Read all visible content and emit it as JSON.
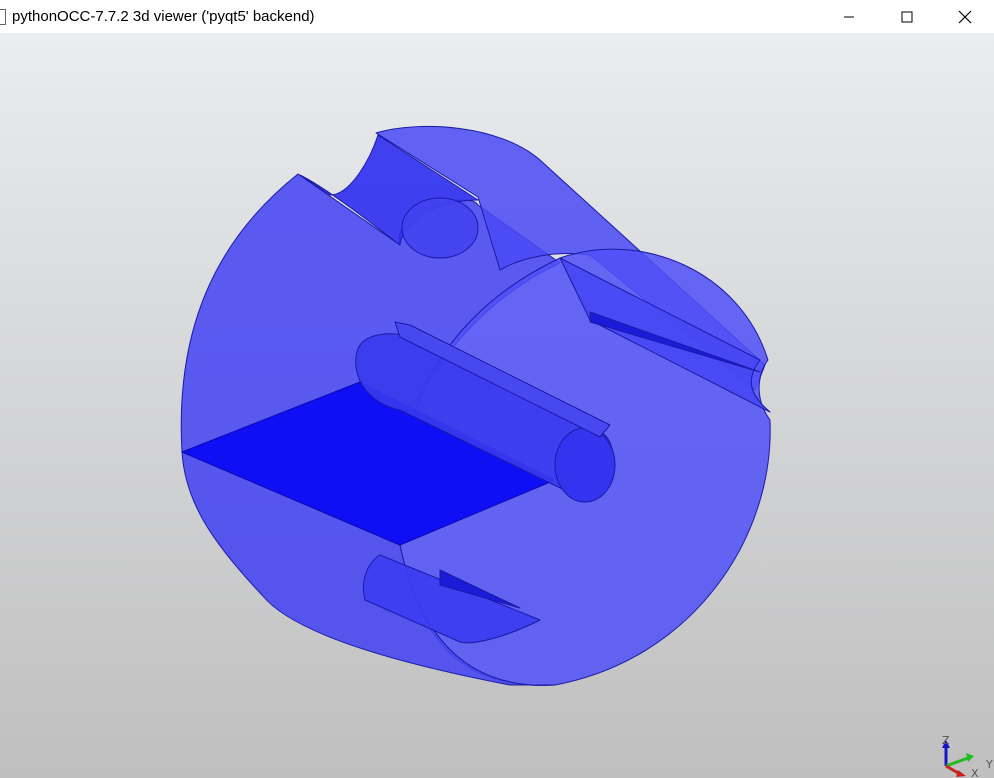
{
  "window": {
    "title": "pythonOCC-7.7.2 3d viewer ('pyqt5' backend)",
    "controls": {
      "minimize_icon": "minimize-icon",
      "maximize_icon": "maximize-icon",
      "close_icon": "close-icon"
    }
  },
  "viewport": {
    "background_top": "#eaecf0",
    "background_bottom": "#bfbfbf",
    "shape_color": "#3b3bf5",
    "shape": "transparent cylindrical part with shaft, slots and planar section",
    "triad": {
      "z_label": "Z",
      "y_label": "Y",
      "x_label": "X",
      "z_color": "#1515c8",
      "y_color": "#22bb22",
      "x_color": "#cc2020"
    }
  }
}
